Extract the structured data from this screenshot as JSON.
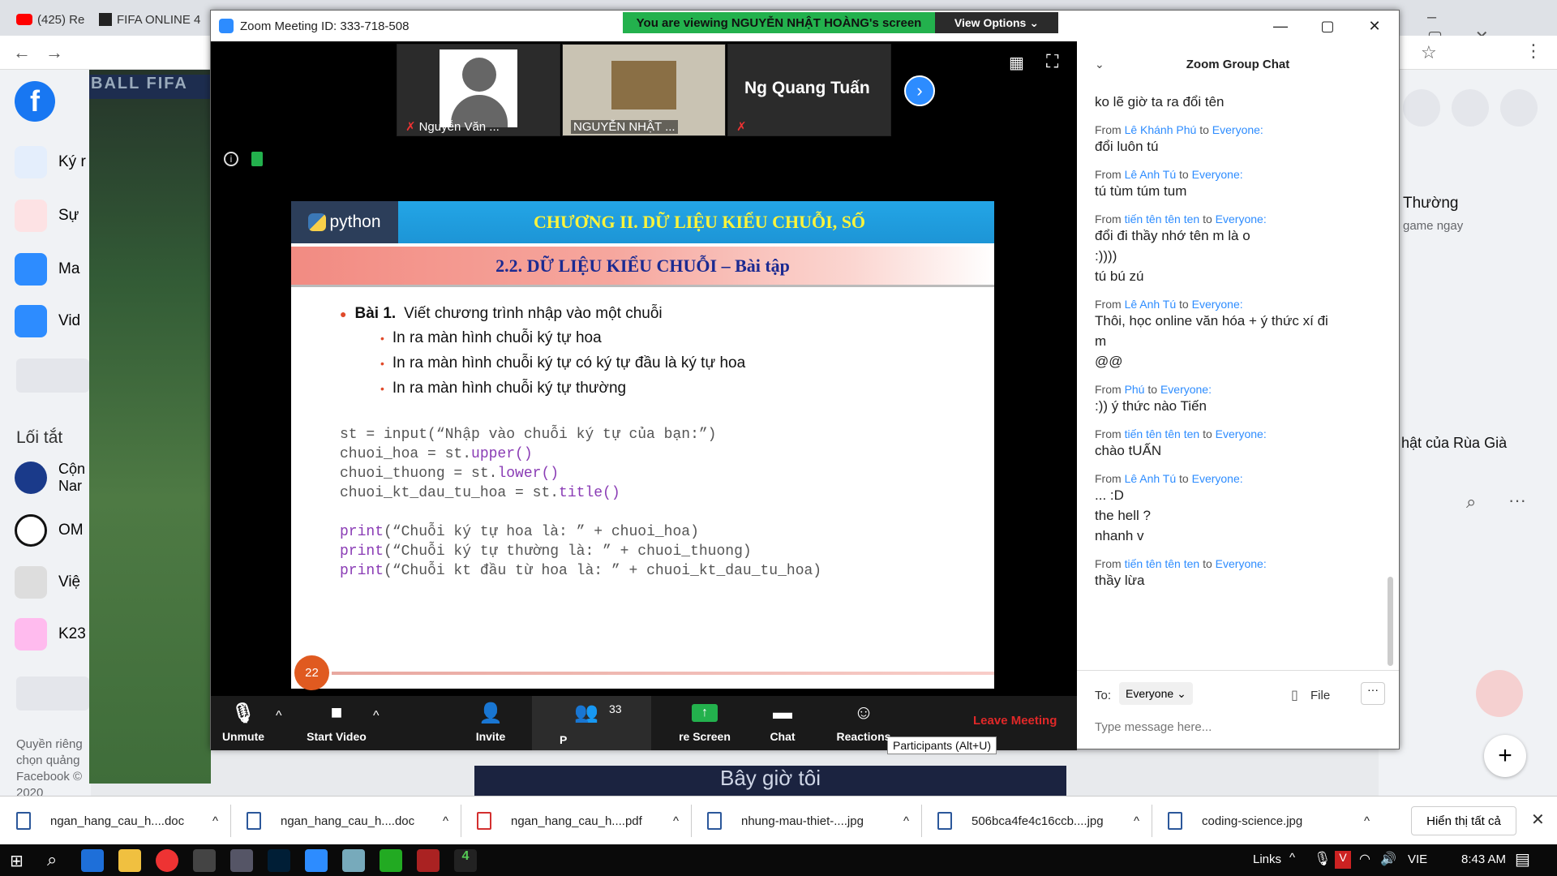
{
  "background": {
    "tab_left": "(425) Re",
    "tab_fifa": "FIFA ONLINE 4",
    "fifa_banner": "BALL FIFA",
    "fb_items": [
      "Ký r",
      "Sự",
      "Ma",
      "Vid"
    ],
    "fb_section": "Lối tắt",
    "fb_shortcuts": [
      "Cộn\nNar",
      "OM",
      "Việ",
      "K23"
    ],
    "fb_footer": [
      "Quyền riêng",
      "chọn quảng",
      "Facebook © 2020"
    ],
    "right_text_1": "Thường",
    "right_text_2": "game ngay",
    "right_text_3": "hật của Rùa Già",
    "bottom_video_text": "Bây giờ tôi"
  },
  "zoom": {
    "title": "Zoom Meeting ID: 333-718-508",
    "share_banner": "You are viewing NGUYỄN NHẬT HOÀNG's screen",
    "view_options": "View Options",
    "participants": [
      {
        "name": "Nguyễn Văn ..."
      },
      {
        "name": "NGUYỄN NHẬT ..."
      },
      {
        "name": "Ng Quang Tuấn"
      }
    ],
    "slide": {
      "logo_text": "python",
      "title": "CHƯƠNG II. DỮ LIỆU KIỂU CHUỖI, SỐ",
      "subtitle": "2.2. DỮ LIỆU KIỂU CHUỖI – Bài tập",
      "bullet_main_bold": "Bài 1.",
      "bullet_main": "Viết chương trình nhập vào một chuỗi",
      "sub_bullets": [
        "In ra màn hình chuỗi ký tự hoa",
        "In ra màn hình chuỗi ký tự có ký tự đầu là ký tự hoa",
        "In ra màn hình chuỗi ký tự thường"
      ],
      "code": [
        {
          "pre": "st = input(“Nhập vào chuỗi ký tự của bạn:”)",
          "kw": "",
          "post": ""
        },
        {
          "pre": "chuoi_hoa = st.",
          "kw": "upper()",
          "post": ""
        },
        {
          "pre": "chuoi_thuong = st.",
          "kw": "lower()",
          "post": ""
        },
        {
          "pre": "chuoi_kt_dau_tu_hoa = st.",
          "kw": "title()",
          "post": ""
        },
        {
          "pre": "",
          "kw": "print",
          "post": "(“Chuỗi ký tự hoa là: ” + chuoi_hoa)"
        },
        {
          "pre": "",
          "kw": "print",
          "post": "(“Chuỗi ký tự thường là: ” + chuoi_thuong)"
        },
        {
          "pre": "",
          "kw": "print",
          "post": "(“Chuỗi kt đầu từ hoa là: ” + chuoi_kt_dau_tu_hoa)"
        }
      ],
      "page": "22"
    },
    "toolbar": {
      "unmute": "Unmute",
      "start_video": "Start Video",
      "invite": "Invite",
      "participants_count": "33",
      "participants_label": "P",
      "share_screen": "re Screen",
      "chat": "Chat",
      "reactions": "Reactions",
      "leave": "Leave Meeting",
      "tooltip": "Participants (Alt+U)"
    },
    "chat": {
      "title": "Zoom Group Chat",
      "first_line": "ko lẽ giờ ta ra đổi tên",
      "messages": [
        {
          "from": "Lê Khánh Phú",
          "to": "Everyone:",
          "lines": [
            "đổi luôn tú"
          ]
        },
        {
          "from": "Lê Anh Tú",
          "to": "Everyone:",
          "lines": [
            "tú tùm túm tum"
          ]
        },
        {
          "from": "tiến tên tên ten",
          "to": "Everyone:",
          "lines": [
            "đổi đi thầy nhớ tên m là o",
            ":))))",
            "tú bú zú"
          ]
        },
        {
          "from": "Lê Anh Tú",
          "to": "Everyone:",
          "lines": [
            "Thôi, học online văn hóa + ý thức xí đi",
            "m",
            "@@"
          ]
        },
        {
          "from": "Phú",
          "to": "Everyone:",
          "lines": [
            ":)) ý thức nào Tiến"
          ]
        },
        {
          "from": "tiến tên tên ten",
          "to": "Everyone:",
          "lines": [
            "chào tUẤN"
          ]
        },
        {
          "from": "Lê Anh Tú",
          "to": "Everyone:",
          "lines": [
            "... :D",
            "the hell ?",
            "nhanh v"
          ]
        },
        {
          "from": "tiến tên tên ten",
          "to": "Everyone:",
          "lines": [
            "thầy lừa"
          ]
        }
      ],
      "from_word": "From",
      "to_word": "to",
      "to_label": "To:",
      "to_value": "Everyone",
      "file": "File",
      "placeholder": "Type message here..."
    }
  },
  "downloads": [
    {
      "name": "ngan_hang_cau_h....doc",
      "type": "doc"
    },
    {
      "name": "ngan_hang_cau_h....doc",
      "type": "doc"
    },
    {
      "name": "ngan_hang_cau_h....pdf",
      "type": "pdf"
    },
    {
      "name": "nhung-mau-thiet-....jpg",
      "type": "jpg"
    },
    {
      "name": "506bca4fe4c16ccb....jpg",
      "type": "jpg"
    },
    {
      "name": "coding-science.jpg",
      "type": "jpg"
    }
  ],
  "show_all": "Hiển thị tất cả",
  "taskbar": {
    "links": "Links",
    "lang": "VIE",
    "time": "8:43 AM"
  }
}
